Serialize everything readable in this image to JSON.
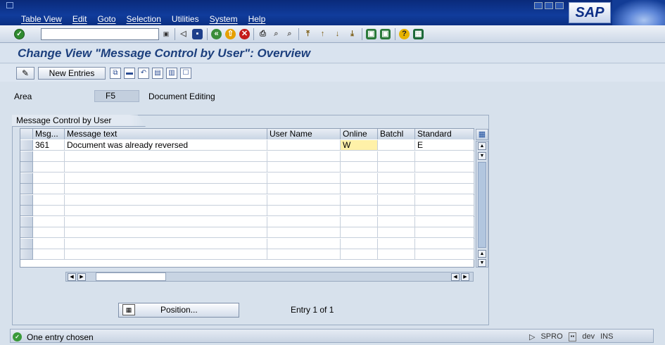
{
  "menu": [
    "Table View",
    "Edit",
    "Goto",
    "Selection",
    "Utilities",
    "System",
    "Help"
  ],
  "brand": "SAP",
  "title": "Change View \"Message Control by User\": Overview",
  "app_toolbar": {
    "new_entries": "New Entries"
  },
  "area": {
    "label": "Area",
    "value": "F5",
    "description": "Document Editing"
  },
  "group_title": "Message Control by User",
  "columns": [
    "Msg...",
    "Message text",
    "User Name",
    "Online",
    "Batchl",
    "Standard"
  ],
  "row": {
    "msg": "361",
    "text": "Document was already reversed",
    "user": "",
    "online": "W",
    "batch": "",
    "standard": "E"
  },
  "position_button": "Position...",
  "entry_info": "Entry 1 of 1",
  "status": {
    "message": "One entry chosen",
    "transaction": "SPRO",
    "system": "dev",
    "mode": "INS"
  }
}
